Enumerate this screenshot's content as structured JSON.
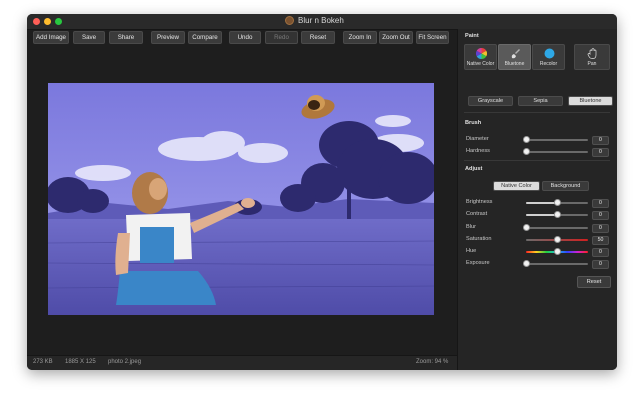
{
  "window": {
    "title": "Blur n Bokeh"
  },
  "toolbar": {
    "add_image": "Add Image",
    "save": "Save",
    "share": "Share",
    "preview": "Preview",
    "compare": "Compare",
    "undo": "Undo",
    "redo": "Redo",
    "reset": "Reset",
    "zoom_in": "Zoom In",
    "zoom_out": "Zoom Out",
    "fit_screen": "Fit Screen"
  },
  "status": {
    "file_size": "273 KB",
    "dimensions": "1885 X 125",
    "filename": "photo 2.jpeg",
    "zoom": "Zoom: 94 %"
  },
  "panel": {
    "paint_label": "Paint",
    "tools": [
      {
        "label": "Native Color",
        "icon": "color-wheel-icon"
      },
      {
        "label": "Bluetone",
        "icon": "brush-icon",
        "active": true
      },
      {
        "label": "Recolor",
        "icon": "recolor-dot-icon"
      },
      {
        "label": "Pan",
        "icon": "hand-icon"
      }
    ],
    "filters": [
      {
        "label": "Grayscale"
      },
      {
        "label": "Sepia"
      },
      {
        "label": "Bluetone",
        "active": true
      }
    ],
    "brush_label": "Brush",
    "brush": [
      {
        "label": "Diameter",
        "value": "0",
        "level": 0
      },
      {
        "label": "Hardness",
        "value": "0",
        "level": 0
      }
    ],
    "adjust_label": "Adjust",
    "adjust_tabs": [
      {
        "label": "Native Color",
        "active": true
      },
      {
        "label": "Background"
      }
    ],
    "adjust": [
      {
        "label": "Brightness",
        "value": "0",
        "level": 0.5
      },
      {
        "label": "Contrast",
        "value": "0",
        "level": 0.5
      },
      {
        "label": "Blur",
        "value": "0",
        "level": 0
      },
      {
        "label": "Saturation",
        "value": "50",
        "level": 0.5
      },
      {
        "label": "Hue",
        "value": "0",
        "level": 0.5
      },
      {
        "label": "Exposure",
        "value": "0",
        "level": 0
      }
    ],
    "reset": "Reset"
  },
  "colors": {
    "window_bg": "#1e1e1e",
    "panel_bg": "#252525",
    "photo_tint": "#8f8ee6",
    "recolor_accent": "#2ea8e6"
  }
}
